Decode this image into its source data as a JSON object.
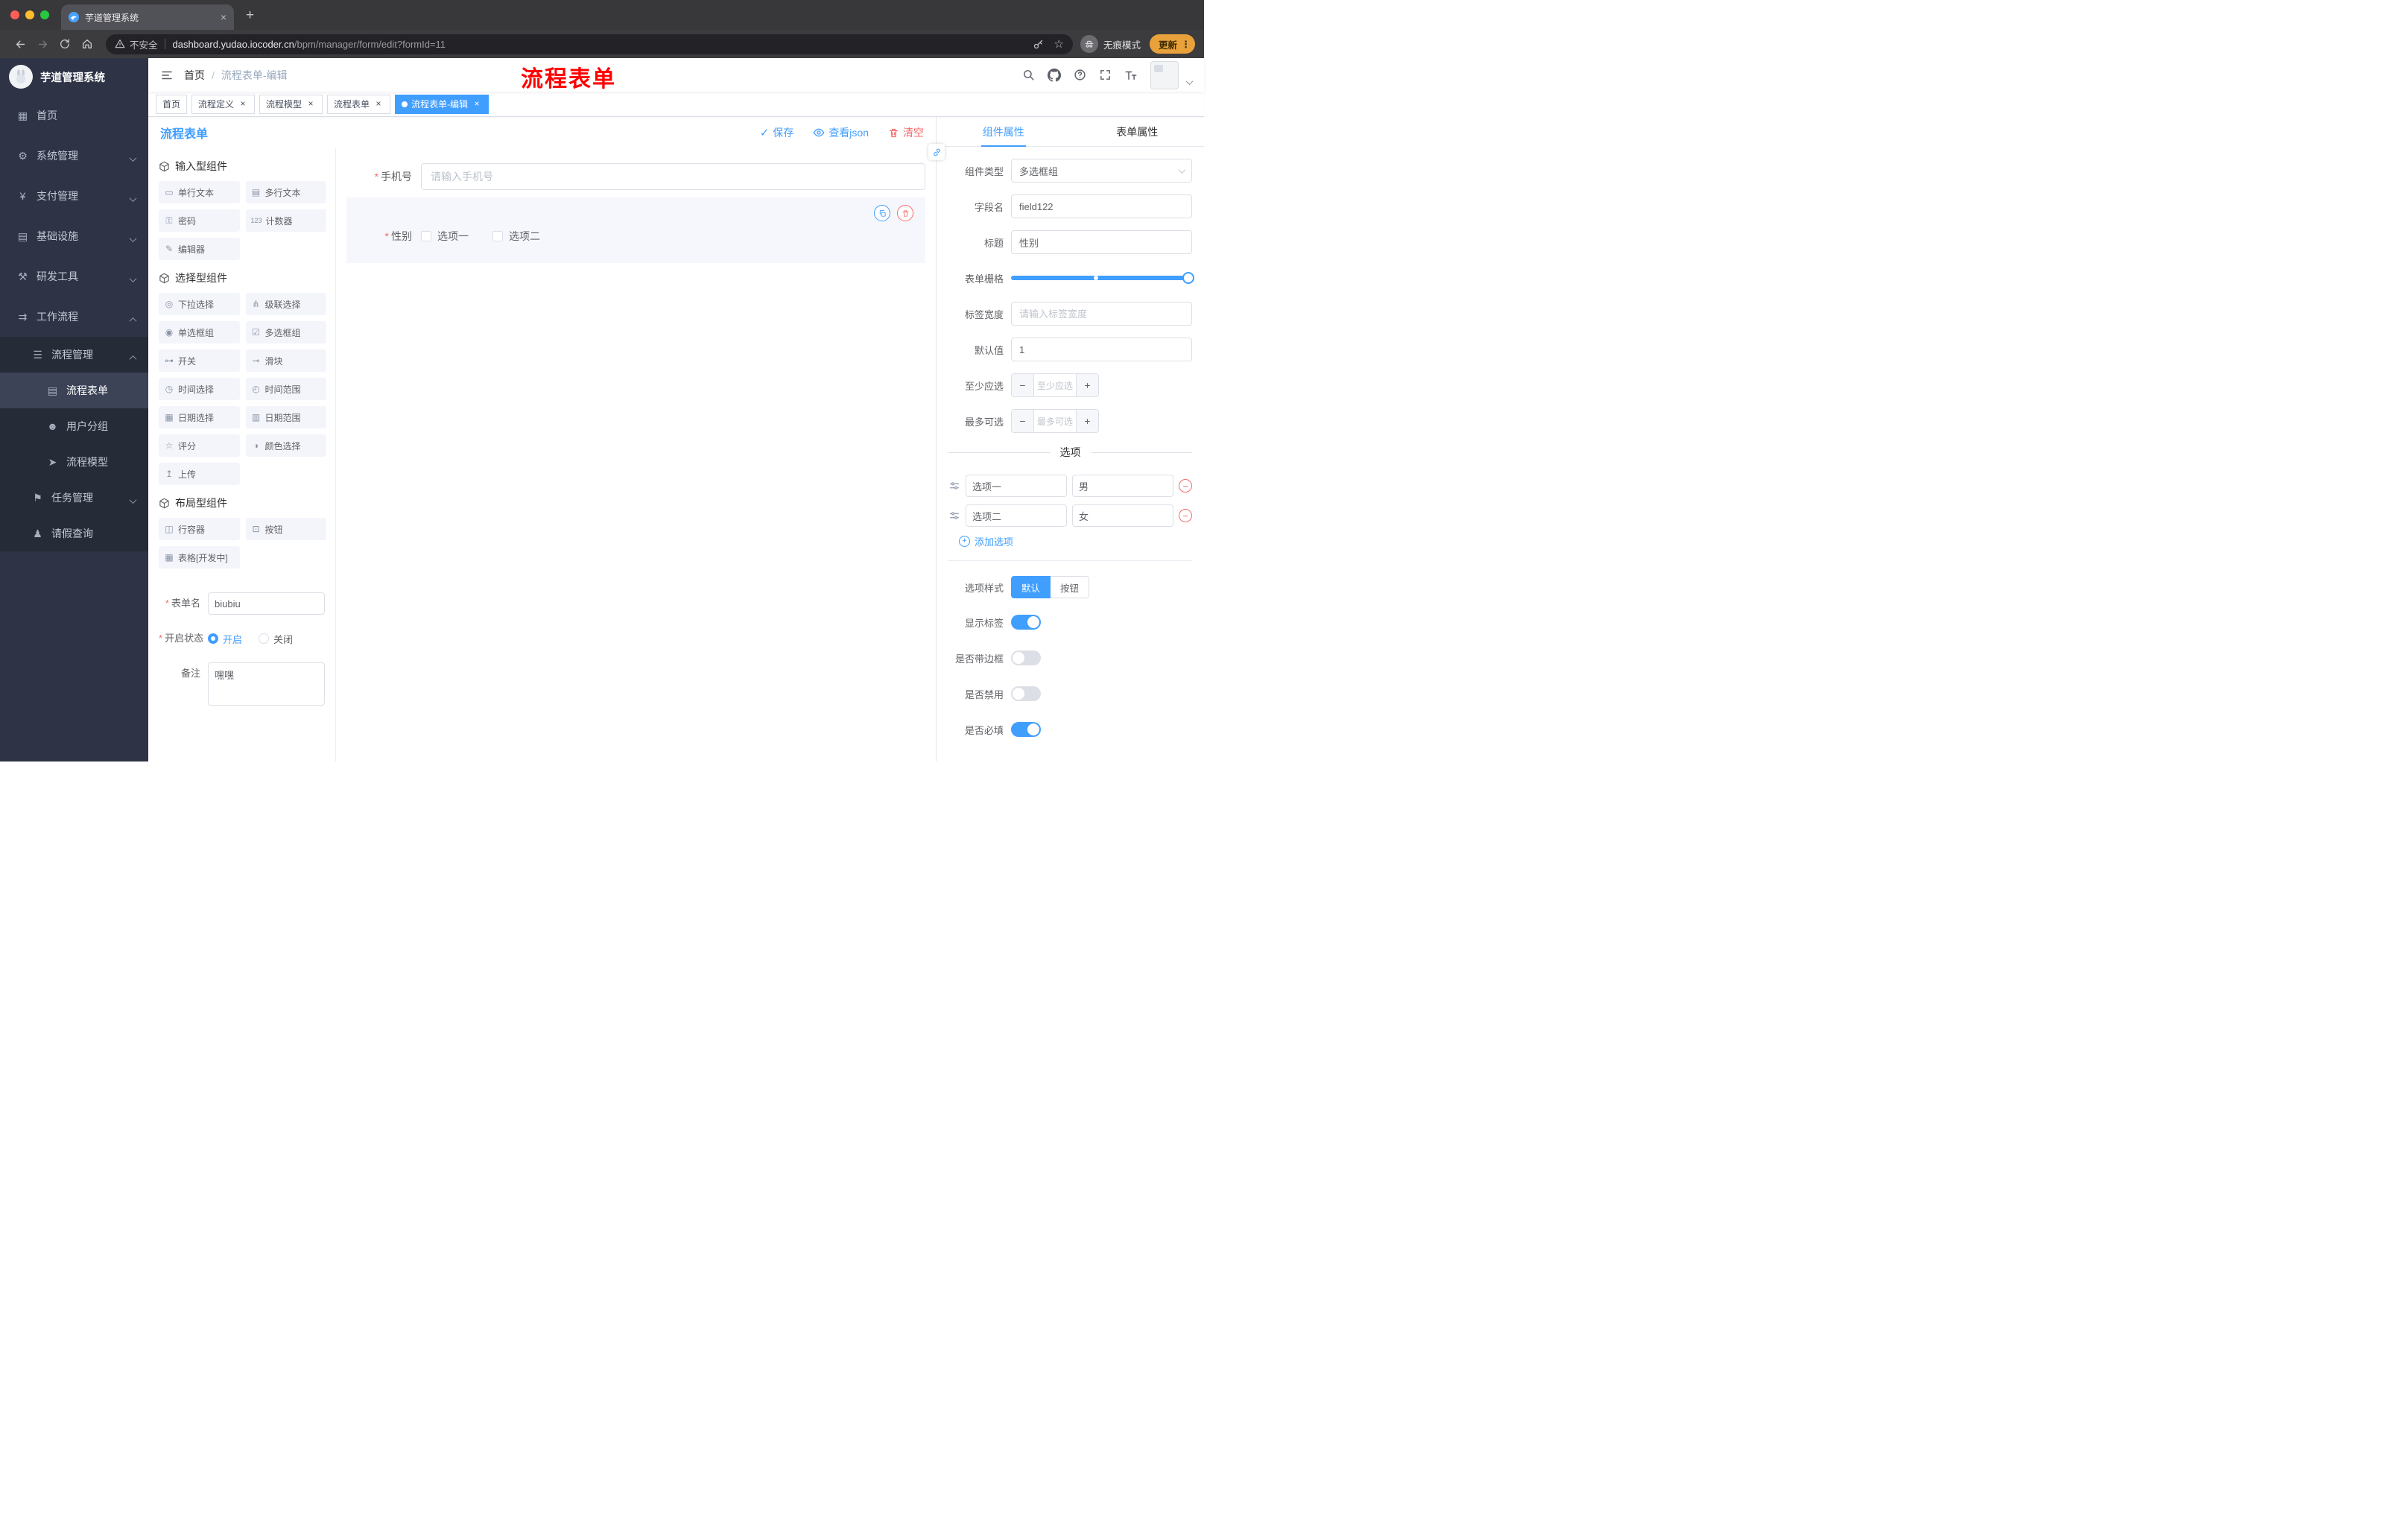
{
  "colors": {
    "accent": "#409EFF",
    "danger": "#F56C6C",
    "annotation_red": "#FF0000",
    "update_orange": "#E9A23B",
    "sidebar_bg": "#2E3446"
  },
  "browser": {
    "tab": {
      "title": "芋道管理系统"
    },
    "url": {
      "security": "不安全",
      "domain": "dashboard.yudao.iocoder.cn",
      "path": "/bpm/manager/form/edit?formId=11"
    },
    "incognito_label": "无痕模式",
    "update_label": "更新"
  },
  "sidebar": {
    "app_title": "芋道管理系统",
    "menu": [
      {
        "name": "home",
        "label": "首页",
        "icon": "dashboard-icon",
        "glyph": "▦",
        "level": 1
      },
      {
        "name": "system-management",
        "label": "系统管理",
        "icon": "gear-icon",
        "glyph": "⚙",
        "level": 1,
        "arrow": "down"
      },
      {
        "name": "payment-management",
        "label": "支付管理",
        "icon": "yen-icon",
        "glyph": "¥",
        "level": 1,
        "arrow": "down"
      },
      {
        "name": "infrastructure",
        "label": "基础设施",
        "icon": "infra-icon",
        "glyph": "▤",
        "level": 1,
        "arrow": "down"
      },
      {
        "name": "dev-tools",
        "label": "研发工具",
        "icon": "tools-icon",
        "glyph": "⚒",
        "level": 1,
        "arrow": "down"
      },
      {
        "name": "workflow",
        "label": "工作流程",
        "icon": "workflow-icon",
        "glyph": "⇉",
        "level": 1,
        "arrow": "up"
      },
      {
        "name": "process-management",
        "label": "流程管理",
        "icon": "list-icon",
        "glyph": "☰",
        "level": 2,
        "arrow": "up",
        "sub": true
      },
      {
        "name": "process-form",
        "label": "流程表单",
        "icon": "form-icon",
        "glyph": "▤",
        "level": 3,
        "active": true,
        "sub": true
      },
      {
        "name": "user-group",
        "label": "用户分组",
        "icon": "user-group-icon",
        "glyph": "☻",
        "level": 3,
        "sub": true
      },
      {
        "name": "process-model",
        "label": "流程模型",
        "icon": "paper-plane-icon",
        "glyph": "➤",
        "level": 3,
        "sub": true
      },
      {
        "name": "task-management",
        "label": "任务管理",
        "icon": "flag-icon",
        "glyph": "⚑",
        "level": 2,
        "arrow": "down",
        "sub": true
      },
      {
        "name": "leave-query",
        "label": "请假查询",
        "icon": "person-icon",
        "glyph": "♟",
        "level": 2,
        "sub": true
      }
    ]
  },
  "navbar": {
    "breadcrumbs": [
      {
        "label": "首页",
        "link": true
      },
      {
        "label": "流程表单-编辑",
        "link": false
      }
    ],
    "annotation": "流程表单"
  },
  "tags": [
    {
      "name": "tag-home",
      "label": "首页",
      "closable": false,
      "active": false
    },
    {
      "name": "tag-process-definition",
      "label": "流程定义",
      "closable": true,
      "active": false
    },
    {
      "name": "tag-process-model",
      "label": "流程模型",
      "closable": true,
      "active": false
    },
    {
      "name": "tag-process-form",
      "label": "流程表单",
      "closable": true,
      "active": false
    },
    {
      "name": "tag-process-form-edit",
      "label": "流程表单-编辑",
      "closable": true,
      "active": true
    }
  ],
  "editor": {
    "title": "流程表单",
    "save_label": "保存",
    "view_json_label": "查看json",
    "clear_label": "清空"
  },
  "components_panel": {
    "sections": [
      {
        "title": "输入型组件",
        "items": [
          {
            "name": "single-line-text",
            "label": "单行文本",
            "glyph": "▭"
          },
          {
            "name": "multi-line-text",
            "label": "多行文本",
            "glyph": "▤"
          },
          {
            "name": "password",
            "label": "密码",
            "glyph": "⚿"
          },
          {
            "name": "counter",
            "label": "计数器",
            "glyph": "123"
          },
          {
            "name": "editor",
            "label": "编辑器",
            "glyph": "✎"
          }
        ]
      },
      {
        "title": "选择型组件",
        "items": [
          {
            "name": "select",
            "label": "下拉选择",
            "glyph": "◎"
          },
          {
            "name": "cascader",
            "label": "级联选择",
            "glyph": "⋔"
          },
          {
            "name": "radio-group",
            "label": "单选框组",
            "glyph": "◉"
          },
          {
            "name": "checkbox-group",
            "label": "多选框组",
            "glyph": "☑"
          },
          {
            "name": "switch",
            "label": "开关",
            "glyph": "⊶"
          },
          {
            "name": "slider",
            "label": "滑块",
            "glyph": "⊸"
          },
          {
            "name": "time-picker",
            "label": "时间选择",
            "glyph": "◷"
          },
          {
            "name": "time-range",
            "label": "时间范围",
            "glyph": "◴"
          },
          {
            "name": "date-picker",
            "label": "日期选择",
            "glyph": "▦"
          },
          {
            "name": "date-range",
            "label": "日期范围",
            "glyph": "▥"
          },
          {
            "name": "rate",
            "label": "评分",
            "glyph": "☆"
          },
          {
            "name": "color-picker",
            "label": "颜色选择",
            "glyph": "◑"
          },
          {
            "name": "upload",
            "label": "上传",
            "glyph": "↥"
          }
        ]
      },
      {
        "title": "布局型组件",
        "items": [
          {
            "name": "row-container",
            "label": "行容器",
            "glyph": "◫"
          },
          {
            "name": "button",
            "label": "按钮",
            "glyph": "⊡"
          },
          {
            "name": "table-dev",
            "label": "表格[开发中]",
            "glyph": "▦"
          }
        ]
      }
    ],
    "form": {
      "name_label": "表单名",
      "name_value": "biubiu",
      "name_required": true,
      "status_label": "开启状态",
      "status_required": true,
      "status_options": [
        {
          "label": "开启",
          "checked": true
        },
        {
          "label": "关闭",
          "checked": false
        }
      ],
      "remark_label": "备注",
      "remark_value": "嘿嘿"
    }
  },
  "canvas": {
    "phone_field": {
      "label": "手机号",
      "required": true,
      "placeholder": "请输入手机号"
    },
    "gender_field": {
      "label": "性别",
      "required": true,
      "options": [
        "选项一",
        "选项二"
      ],
      "selected": true
    }
  },
  "props": {
    "tabs": [
      {
        "label": "组件属性",
        "active": true
      },
      {
        "label": "表单属性",
        "active": false
      }
    ],
    "component_type": {
      "label": "组件类型",
      "value": "多选框组"
    },
    "field_name": {
      "label": "字段名",
      "value": "field122"
    },
    "title": {
      "label": "标题",
      "value": "性别"
    },
    "grid": {
      "label": "表单栅格",
      "value_percent": 100,
      "mark_percent": 47
    },
    "label_width": {
      "label": "标签宽度",
      "placeholder": "请输入标签宽度"
    },
    "default_value": {
      "label": "默认值",
      "value": "1"
    },
    "min_select": {
      "label": "至少应选",
      "placeholder": "至少应选"
    },
    "max_select": {
      "label": "最多可选",
      "placeholder": "最多可选"
    },
    "options_title": "选项",
    "options": [
      {
        "label": "选项一",
        "value": "男"
      },
      {
        "label": "选项二",
        "value": "女"
      }
    ],
    "add_option_label": "添加选项",
    "option_style": {
      "label": "选项样式",
      "choices": [
        "默认",
        "按钮"
      ],
      "active_index": 0
    },
    "switches": [
      {
        "name": "show-label",
        "label": "显示标签",
        "on": true
      },
      {
        "name": "with-border",
        "label": "是否带边框",
        "on": false
      },
      {
        "name": "disabled",
        "label": "是否禁用",
        "on": false
      },
      {
        "name": "required",
        "label": "是否必填",
        "on": true
      }
    ]
  }
}
